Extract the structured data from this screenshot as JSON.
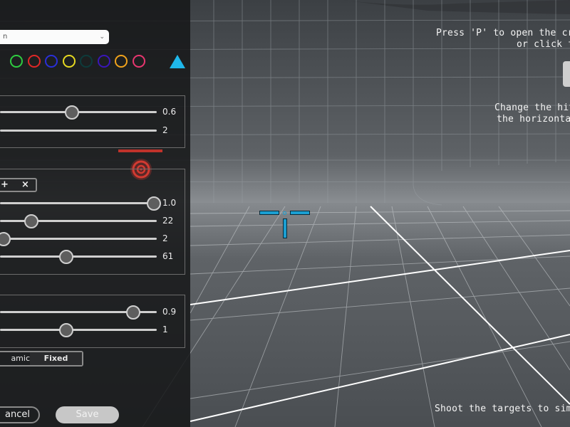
{
  "panel": {
    "dropdown": {
      "value": "n",
      "chevron_icon": "chevron-down-icon"
    },
    "colors": [
      "#2ecc40",
      "#e02727",
      "#2a2fd8",
      "#e6d820",
      "#0d3b3b",
      "#3a16b8",
      "#f0a21c",
      "#e8366f"
    ],
    "shape_icon": "triangle-icon",
    "shape_color": "#1fb7ea",
    "group1": {
      "sliders": [
        {
          "value_label": "0.6",
          "fraction": 0.455
        },
        {
          "value_label": "2",
          "fraction": null
        }
      ]
    },
    "group2": {
      "buttons": {
        "add": "+",
        "remove": "×"
      },
      "sliders": [
        {
          "value_label": "1.0",
          "fraction": 0.975
        },
        {
          "value_label": "22",
          "fraction": 0.195
        },
        {
          "value_label": "2",
          "fraction": 0.02
        },
        {
          "value_label": "61",
          "fraction": 0.42
        }
      ]
    },
    "group3": {
      "sliders": [
        {
          "value_label": "0.9",
          "fraction": 0.845
        },
        {
          "value_label": "1",
          "fraction": 0.42
        }
      ]
    },
    "mode_toggle": {
      "left": "amic",
      "right": "Fixed"
    },
    "cancel_label": "ancel",
    "save_label": "Save"
  },
  "overlay": {
    "line1": "Press 'P' to open the cros",
    "line2": "or click th",
    "line3": "Change the hit",
    "line4": "the horizontal",
    "bottom": "Shoot the targets to simu"
  },
  "accent": "#1a9fd2",
  "target_color": "#c0322b"
}
